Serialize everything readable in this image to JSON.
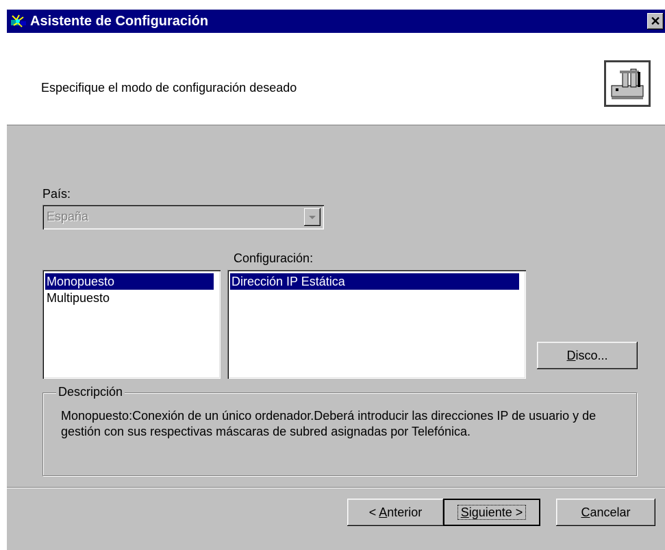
{
  "window": {
    "title": "Asistente de Configuración",
    "close_glyph": "✕"
  },
  "header": {
    "instruction": "Especifique el modo de configuración deseado",
    "icon": "network-setup-icon"
  },
  "country": {
    "label": "País:",
    "value": "España"
  },
  "mode_list": {
    "items": [
      "Monopuesto",
      "Multipuesto"
    ],
    "selected": "Monopuesto"
  },
  "configuration": {
    "label": "Configuración:",
    "items": [
      "Dirección IP Estática"
    ],
    "selected": "Dirección IP Estática"
  },
  "disk_button": {
    "mnemonic": "D",
    "rest": "isco..."
  },
  "description": {
    "legend": "Descripción",
    "text": "Monopuesto:Conexión de un único ordenador.Deberá introducir las direcciones IP de usuario y de gestión con sus respectivas máscaras de subred asignadas por Telefónica."
  },
  "footer": {
    "back": {
      "prefix": "< ",
      "mnemonic": "A",
      "rest": "nterior"
    },
    "next": {
      "mnemonic": "S",
      "rest": "iguiente >"
    },
    "cancel": {
      "mnemonic": "C",
      "rest": "ancelar"
    }
  },
  "colors": {
    "titlebar": "#000080",
    "face": "#c0c0c0",
    "selection": "#000080"
  }
}
